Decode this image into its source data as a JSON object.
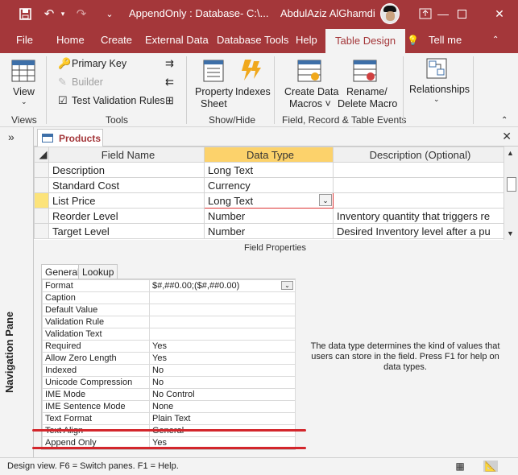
{
  "titlebar": {
    "save_icon": "save-icon",
    "undo_icon": "undo-icon",
    "redo_icon": "redo-icon",
    "title": "AppendOnly : Database- C:\\...",
    "user": "AbdulAziz AlGhamdi"
  },
  "ribbon_tabs": [
    "File",
    "Home",
    "Create",
    "External Data",
    "Database Tools",
    "Help",
    "Table Design",
    "Tell me"
  ],
  "active_tab": "Table Design",
  "ribbon": {
    "views": {
      "view_label": "View",
      "group": "Views"
    },
    "tools": {
      "primary_key": "Primary Key",
      "builder": "Builder",
      "test_validation": "Test Validation Rules",
      "group": "Tools"
    },
    "showhide": {
      "property_sheet_1": "Property",
      "property_sheet_2": "Sheet",
      "indexes": "Indexes",
      "group": "Show/Hide"
    },
    "events": {
      "create_data_macros_1": "Create Data",
      "create_data_macros_2": "Macros ˅",
      "rename_delete_macro_1": "Rename/",
      "rename_delete_macro_2": "Delete Macro",
      "group": "Field, Record & Table Events"
    },
    "relationships": {
      "label": "Relationships"
    }
  },
  "nav_pane_label": "Navigation Pane",
  "doc_tab": "Products",
  "grid": {
    "headers": [
      "Field Name",
      "Data Type",
      "Description (Optional)"
    ],
    "rows": [
      {
        "field": "Description",
        "type": "Long Text",
        "desc": ""
      },
      {
        "field": "Standard Cost",
        "type": "Currency",
        "desc": ""
      },
      {
        "field": "List Price",
        "type": "Long Text",
        "desc": ""
      },
      {
        "field": "Reorder Level",
        "type": "Number",
        "desc": "Inventory quantity that triggers re"
      },
      {
        "field": "Target Level",
        "type": "Number",
        "desc": "Desired Inventory level after a pu"
      }
    ]
  },
  "field_properties_title": "Field Properties",
  "prop_tabs": [
    "General",
    "Lookup"
  ],
  "properties": [
    {
      "name": "Format",
      "value": "$#,##0.00;($#,##0.00)"
    },
    {
      "name": "Caption",
      "value": ""
    },
    {
      "name": "Default Value",
      "value": ""
    },
    {
      "name": "Validation Rule",
      "value": ""
    },
    {
      "name": "Validation Text",
      "value": ""
    },
    {
      "name": "Required",
      "value": "Yes"
    },
    {
      "name": "Allow Zero Length",
      "value": "Yes"
    },
    {
      "name": "Indexed",
      "value": "No"
    },
    {
      "name": "Unicode Compression",
      "value": "No"
    },
    {
      "name": "IME Mode",
      "value": "No Control"
    },
    {
      "name": "IME Sentence Mode",
      "value": "None"
    },
    {
      "name": "Text Format",
      "value": "Plain Text"
    },
    {
      "name": "Text Align",
      "value": "General"
    },
    {
      "name": "Append Only",
      "value": "Yes"
    }
  ],
  "help_text": "The data type determines the kind of values that users can store in the field. Press F1 for help on data types.",
  "status": "Design view.  F6 = Switch panes.  F1 = Help.",
  "colors": {
    "accent": "#a4373a",
    "annotation": "#d3262c"
  }
}
